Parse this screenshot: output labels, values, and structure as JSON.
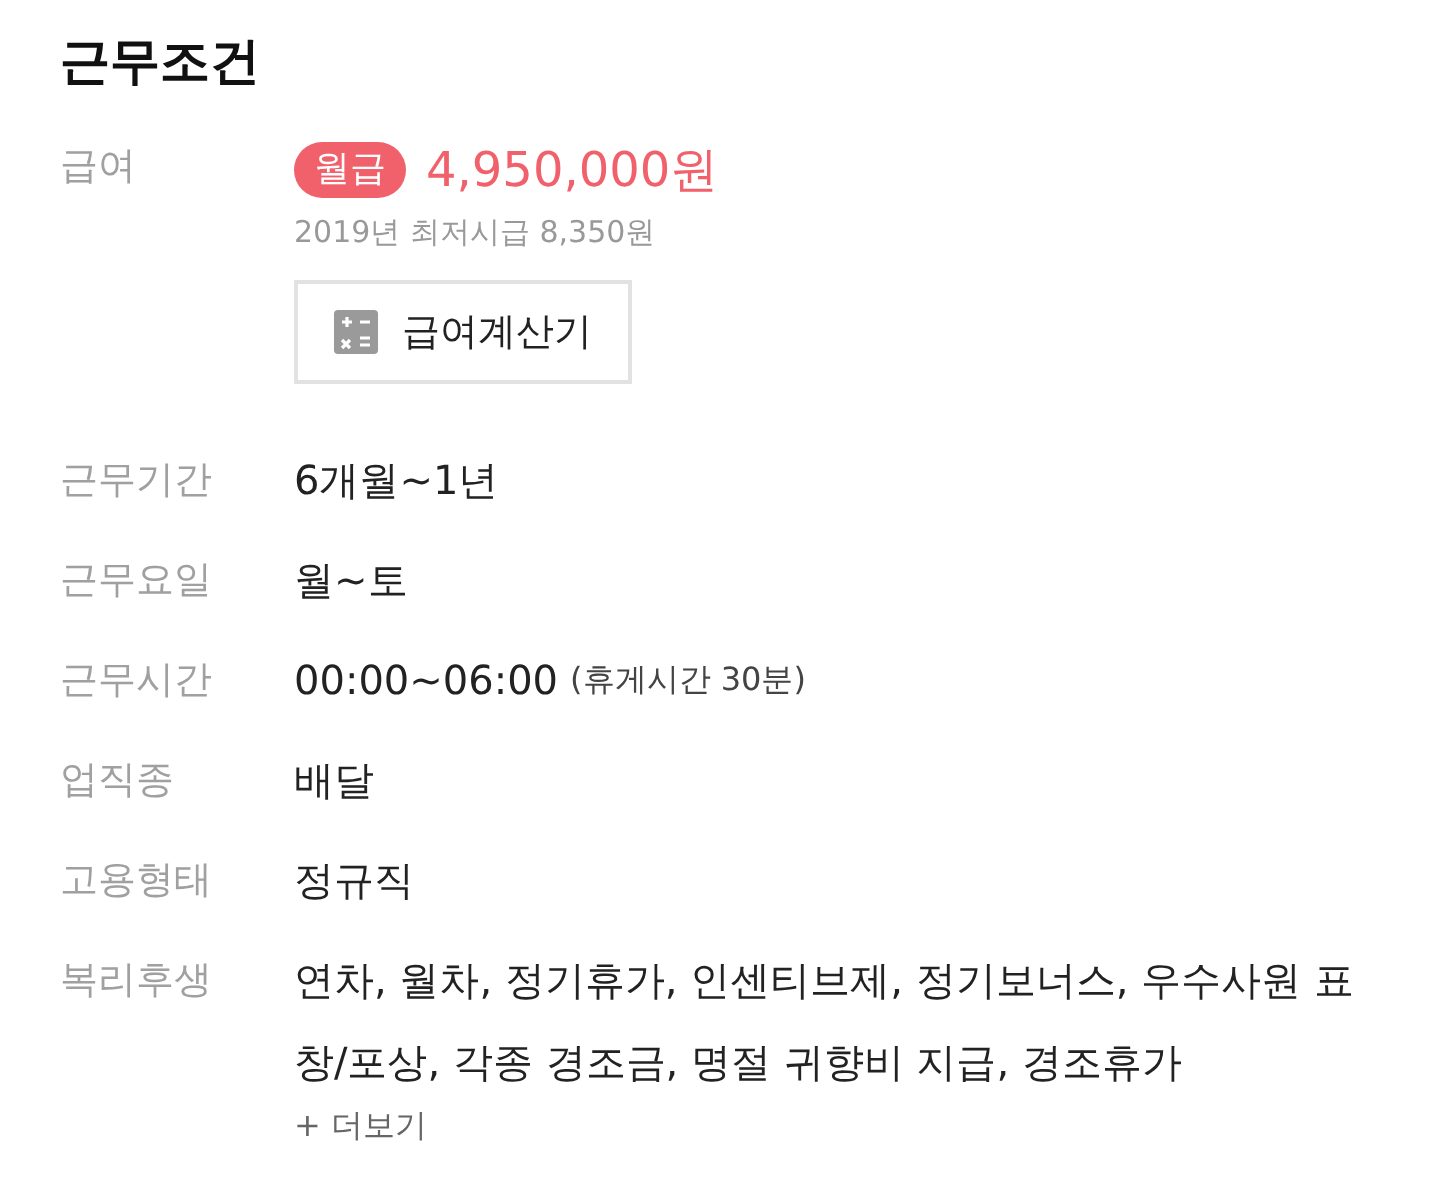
{
  "title": "근무조건",
  "salary": {
    "label": "급여",
    "badge": "월급",
    "amount": "4,950,000원",
    "note": "2019년 최저시급 8,350원",
    "calculator_button": "급여계산기"
  },
  "rows": [
    {
      "label": "근무기간",
      "value": "6개월~1년"
    },
    {
      "label": "근무요일",
      "value": "월~토"
    },
    {
      "label": "근무시간",
      "value": "00:00~06:00",
      "note": "(휴게시간 30분)"
    },
    {
      "label": "업직종",
      "value": "배달"
    },
    {
      "label": "고용형태",
      "value": "정규직"
    },
    {
      "label": "복리후생",
      "value": "연차, 월차, 정기휴가, 인센티브제, 정기보너스, 우수사원 표창/포상, 각종 경조금, 명절 귀향비 지급, 경조휴가",
      "more_link": "+ 더보기"
    }
  ]
}
